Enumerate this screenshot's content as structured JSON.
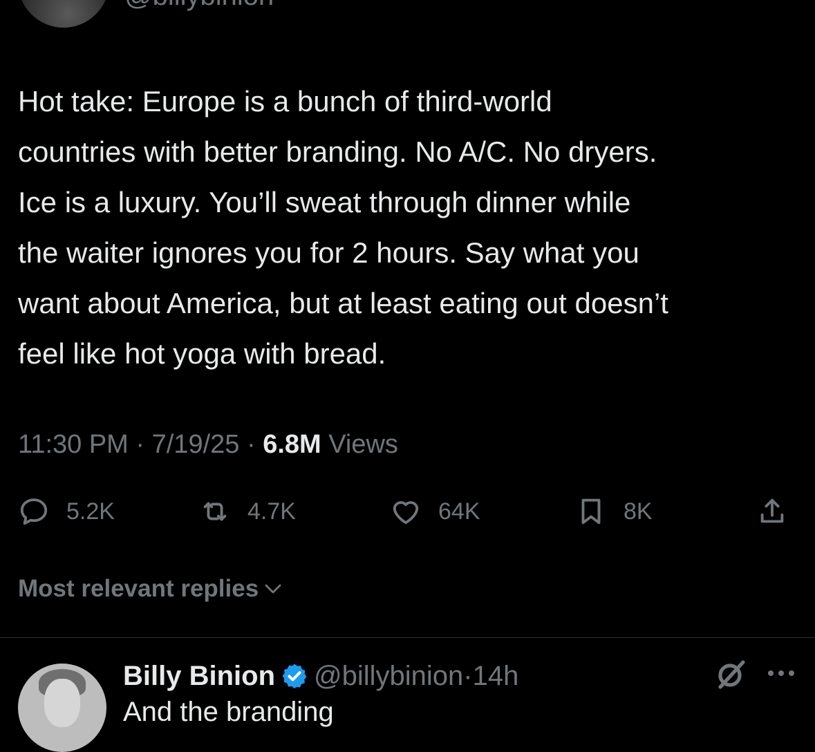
{
  "author": {
    "handle": "@billybinion"
  },
  "tweet": {
    "text": "Hot take: Europe is a bunch of third-world\ncountries with better branding. No A/C. No dryers.\nIce is a luxury. You’ll sweat through dinner while\nthe waiter ignores you for 2 hours. Say what you\nwant about America, but at least eating out doesn’t\nfeel like hot yoga with bread.",
    "time": "11:30 PM",
    "date": "7/19/25",
    "separator": "·",
    "views_count": "6.8M",
    "views_label": "Views"
  },
  "actions": {
    "replies": {
      "icon": "reply-icon",
      "count": "5.2K"
    },
    "reposts": {
      "icon": "repost-icon",
      "count": "4.7K"
    },
    "likes": {
      "icon": "heart-icon",
      "count": "64K"
    },
    "bookmarks": {
      "icon": "bookmark-icon",
      "count": "8K"
    },
    "share": {
      "icon": "share-icon"
    }
  },
  "replies_sort": {
    "label": "Most relevant replies",
    "icon": "chevron-down-icon"
  },
  "reply": {
    "name": "Billy Binion",
    "verified_icon": "verified-badge-icon",
    "handle": "@billybinion",
    "separator": "·",
    "age": "14h",
    "preview": "And the branding"
  },
  "colors": {
    "background": "#000000",
    "primary_text": "#e7e9ea",
    "secondary_text": "#71767b",
    "divider": "#2f3336",
    "verified": "#1d9bf0"
  }
}
